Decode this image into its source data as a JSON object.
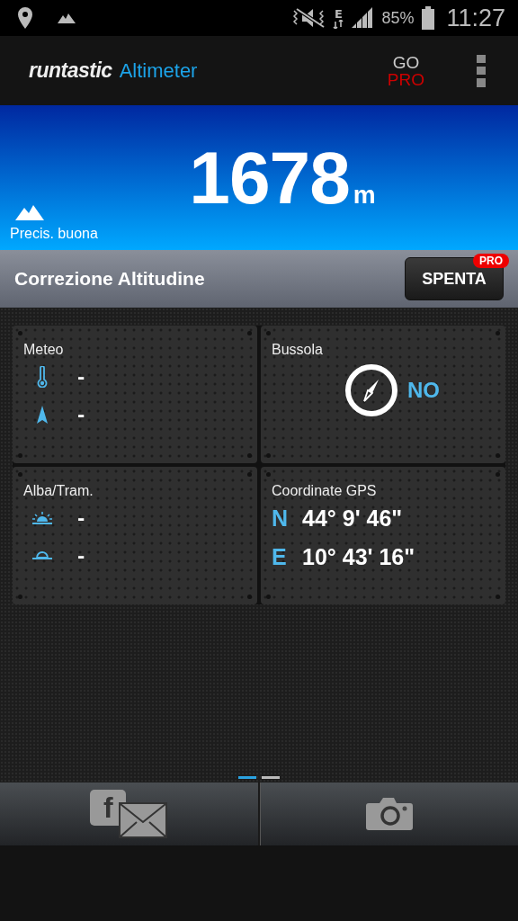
{
  "status_bar": {
    "network": "E",
    "battery": "85%",
    "time": "11:27"
  },
  "app_bar": {
    "brand": "runtastic",
    "title": "Altimeter",
    "go": "GO",
    "pro": "PRO"
  },
  "altitude": {
    "value": "1678",
    "unit": "m",
    "precision": "Precis. buona"
  },
  "correction": {
    "label": "Correzione Altitudine",
    "button": "SPENTA",
    "badge": "PRO"
  },
  "panels": [
    {
      "kind": "weather",
      "title": "Meteo",
      "rows": [
        {
          "kind": "thermometer",
          "value": "-"
        },
        {
          "kind": "pressure",
          "value": "-"
        }
      ]
    },
    {
      "kind": "compass",
      "title": "Bussola",
      "direction": "NO"
    },
    {
      "kind": "sun",
      "title": "Alba/Tram.",
      "rows": [
        {
          "kind": "sunrise",
          "value": "-"
        },
        {
          "kind": "sunset",
          "value": "-"
        }
      ]
    },
    {
      "kind": "gps",
      "title": "Coordinate GPS",
      "rows": [
        {
          "axis": "N",
          "value": "44° 9' 46\""
        },
        {
          "axis": "E",
          "value": "10° 43' 16\""
        }
      ]
    }
  ],
  "pages": [
    {
      "selected": true
    },
    {
      "selected": false
    }
  ],
  "bottom_bar": {
    "share_letter": "f"
  }
}
